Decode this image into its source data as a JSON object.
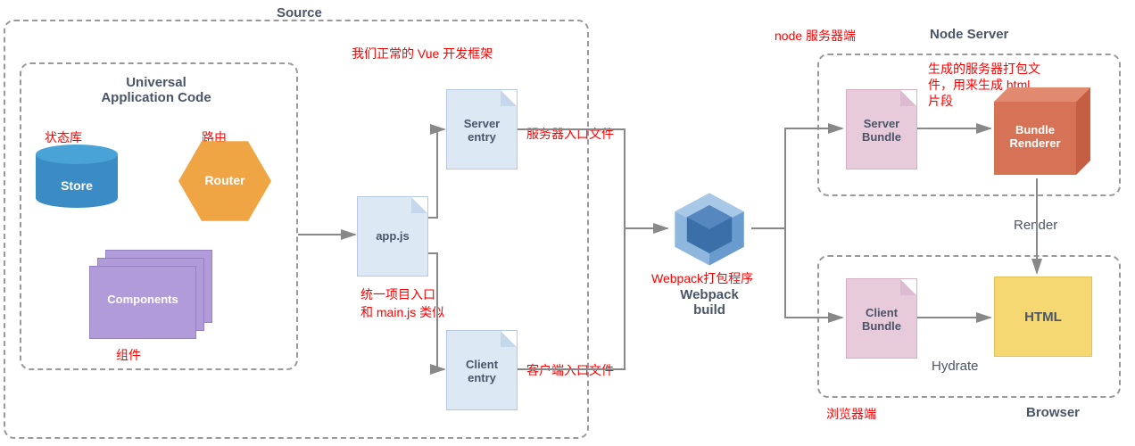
{
  "source": {
    "title": "Source",
    "universal_code_title": "Universal\nApplication Code",
    "store": {
      "label": "Store",
      "annotation": "状态库"
    },
    "router": {
      "label": "Router",
      "annotation": "路由"
    },
    "components": {
      "label": "Components",
      "annotation": "组件"
    },
    "app_js": {
      "label": "app.js",
      "annotation_top": "我们正常的 Vue 开发框架",
      "annotation_bottom": "统一项目入口\n和 main.js 类似"
    },
    "server_entry": {
      "label": "Server\nentry",
      "annotation": "服务器入口文件"
    },
    "client_entry": {
      "label": "Client\nentry",
      "annotation": "客户端入口文件"
    }
  },
  "webpack": {
    "label": "Webpack\nbuild",
    "annotation": "Webpack打包程序"
  },
  "node_server": {
    "title": "Node Server",
    "annotation": "node 服务器端",
    "server_bundle": {
      "label": "Server\nBundle"
    },
    "bundle_renderer": {
      "label": "Bundle\nRenderer",
      "annotation": "生成的服务器打包文\n件，用来生成 html\n片段"
    }
  },
  "browser": {
    "title": "Browser",
    "annotation": "浏览器端",
    "client_bundle": {
      "label": "Client\nBundle"
    },
    "html": {
      "label": "HTML"
    }
  },
  "edges": {
    "render": "Render",
    "hydrate": "Hydrate"
  }
}
